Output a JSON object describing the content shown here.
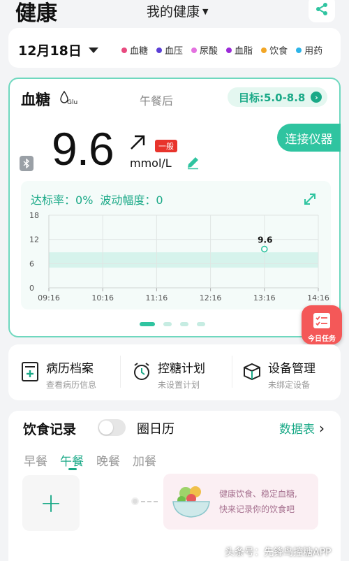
{
  "header": {
    "app_title": "健康",
    "page_selector": "我的健康",
    "share_icon": "share-icon"
  },
  "date_bar": {
    "date": "12月18日",
    "legend": [
      {
        "label": "血糖",
        "color": "#e84a7f"
      },
      {
        "label": "血压",
        "color": "#5b3fd6"
      },
      {
        "label": "尿酸",
        "color": "#e472e0"
      },
      {
        "label": "血脂",
        "color": "#9b2ad8"
      },
      {
        "label": "饮食",
        "color": "#f2a626"
      },
      {
        "label": "用药",
        "color": "#2db4e8"
      }
    ]
  },
  "glucose": {
    "title": "血糖",
    "glu_label": "Glu",
    "meal": "午餐后",
    "target": "目标:5.0-8.8",
    "value": "9.6",
    "unit": "mmol/L",
    "level_badge": "一般",
    "connect_button": "连接仪器",
    "stats": {
      "rate_label": "达标率：",
      "rate_value": "0%",
      "fluct_label": "波动幅度：",
      "fluct_value": "0"
    },
    "accent_color": "#2fc4a0",
    "alert_color": "#e8342c"
  },
  "chart_data": {
    "type": "scatter",
    "x_ticks": [
      "09:16",
      "10:16",
      "11:16",
      "12:16",
      "13:16",
      "14:16"
    ],
    "y_ticks": [
      0,
      6,
      12,
      18
    ],
    "ylim": [
      0,
      18
    ],
    "target_band": [
      5.0,
      8.8
    ],
    "points": [
      {
        "x": "13:16",
        "y": 9.6,
        "label": "9.6"
      }
    ],
    "grid": true
  },
  "carousel": {
    "count": 4,
    "active": 0
  },
  "task_button": {
    "label": "今日任务"
  },
  "quick_links": [
    {
      "title": "病历档案",
      "subtitle": "查看病历信息",
      "icon": "medical-record-icon"
    },
    {
      "title": "控糖计划",
      "subtitle": "未设置计划",
      "icon": "alarm-clock-icon"
    },
    {
      "title": "设备管理",
      "subtitle": "未绑定设备",
      "icon": "cube-device-icon"
    }
  ],
  "diet": {
    "title": "饮食记录",
    "calendar_label": "圈日历",
    "data_table": "数据表",
    "tabs": [
      "早餐",
      "午餐",
      "晚餐",
      "加餐"
    ],
    "active_tab": 1,
    "add_symbol": "+",
    "tip_line1": "健康饮食、稳定血糖,",
    "tip_line2": "快来记录你的饮食吧"
  },
  "watermark": "头条号：先锋鸟控糖APP"
}
